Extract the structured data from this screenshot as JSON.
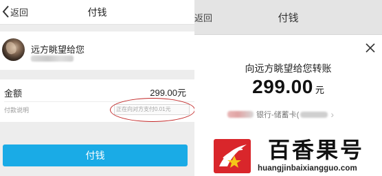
{
  "left": {
    "back_label": "返回",
    "title": "付钱",
    "payee_name": "远方眺望给您",
    "amount_label": "金额",
    "amount_value": "299.00元",
    "note_label": "付款说明",
    "note_placeholder": "正在向对方支付0.01元",
    "pay_button": "付钱"
  },
  "right": {
    "back_label": "返回",
    "title": "付钱",
    "transfer_text": "向远方眺望给您转账",
    "amount": "299.00",
    "amount_unit": "元",
    "card_label": "银行-储蓄卡("
  },
  "watermark": {
    "brand": "百香果号",
    "domain": "huangjinbaixiangguo.com"
  },
  "colors": {
    "pay_button": "#1aabe6",
    "highlight_ellipse": "#c22626",
    "logo_red": "#d9262b"
  },
  "icons": [
    "chevron-left-icon",
    "close-icon",
    "chevron-right-icon",
    "logo-icon"
  ]
}
